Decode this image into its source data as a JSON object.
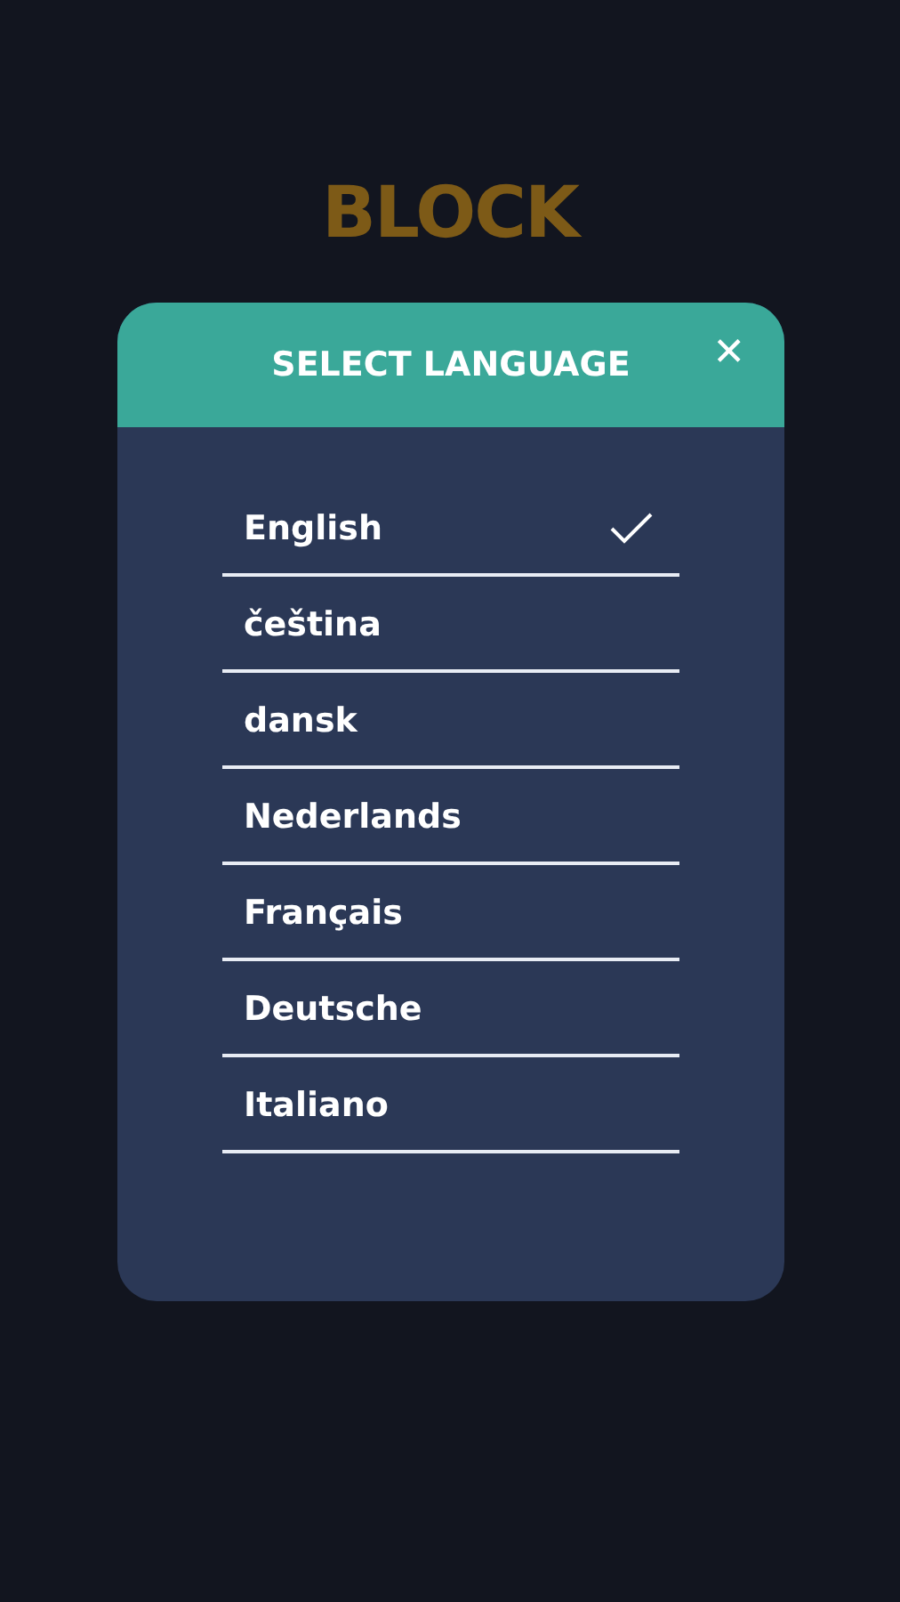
{
  "logo": {
    "lines": [
      "BLOCK"
    ]
  },
  "dialog": {
    "title": "SELECT LANGUAGE",
    "close": "✕",
    "languages": [
      {
        "label": "English",
        "selected": true
      },
      {
        "label": "čeština",
        "selected": false
      },
      {
        "label": "dansk",
        "selected": false
      },
      {
        "label": "Nederlands",
        "selected": false
      },
      {
        "label": "Français",
        "selected": false
      },
      {
        "label": "Deutsche",
        "selected": false
      },
      {
        "label": "Italiano",
        "selected": false
      }
    ]
  }
}
